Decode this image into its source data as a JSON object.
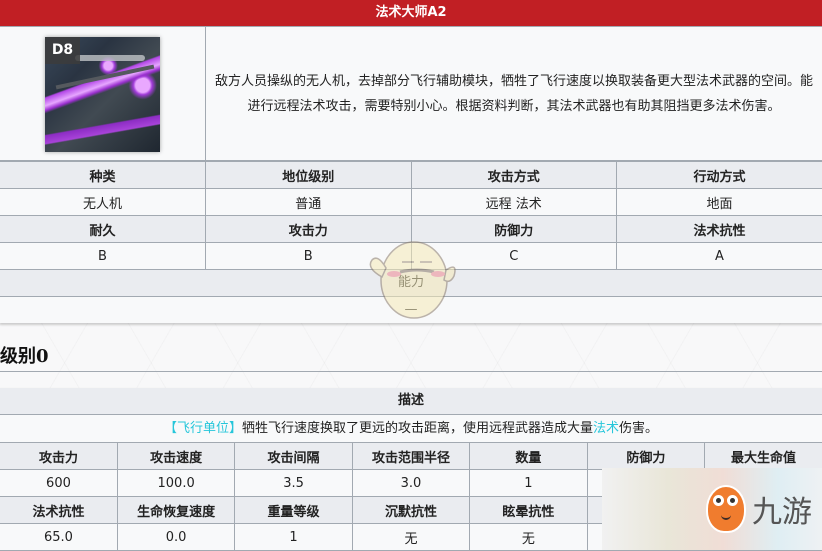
{
  "enemy": {
    "title": "法术大师A2",
    "rank_badge": "D8",
    "description": "敌方人员操纵的无人机，去掉部分飞行辅助模块，牺牲了飞行速度以换取装备更大型法术武器的空间。能进行远程法术攻击，需要特别小心。根据资料判断，其法术武器也有助其阻挡更多法术伤害。",
    "info_table": {
      "header_row_1": [
        "种类",
        "地位级别",
        "攻击方式",
        "行动方式"
      ],
      "value_row_1": [
        "无人机",
        "普通",
        "远程 法术",
        "地面"
      ],
      "header_row_2": [
        "耐久",
        "攻击力",
        "防御力",
        "法术抗性"
      ],
      "value_row_2": [
        "B",
        "B",
        "C",
        "A"
      ]
    },
    "ability_label": "能力",
    "ability_value": "—"
  },
  "level_section": {
    "title": "级别0",
    "description_header": "描述",
    "talent": {
      "tag": "【飞行单位】",
      "text_before": "牺牲飞行速度换取了更远的攻击距离，使用远程武器造成大量",
      "keyword": "法术",
      "text_after": "伤害。"
    },
    "stats_table": {
      "header_row_1": [
        "攻击力",
        "攻击速度",
        "攻击间隔",
        "攻击范围半径",
        "数量",
        "防御力",
        "最大生命值"
      ],
      "value_row_1": [
        "600",
        "100.0",
        "3.5",
        "3.0",
        "1",
        "",
        ""
      ],
      "header_row_2": [
        "法术抗性",
        "生命恢复速度",
        "重量等级",
        "沉默抗性",
        "眩晕抗性",
        ""
      ],
      "value_row_2": [
        "65.0",
        "0.0",
        "1",
        "无",
        "无",
        ""
      ]
    }
  },
  "watermark": {
    "text": "九游"
  },
  "colors": {
    "title_bar": "#c11f24",
    "header_bg": "#eaecf0",
    "border": "#a2a9b1",
    "highlight": "#26c6da"
  }
}
